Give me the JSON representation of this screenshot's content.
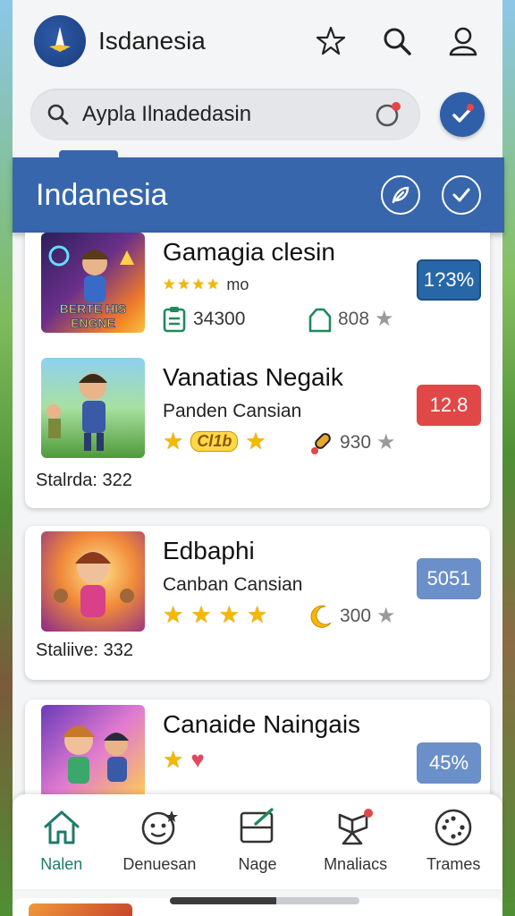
{
  "header": {
    "app_title": "Isdanesia"
  },
  "search": {
    "value": "Aypla Ilnadedasin"
  },
  "banner": {
    "title": "Indanesia"
  },
  "games": [
    {
      "title": "Gamagia clesin",
      "rating_text": "mo",
      "stat_value": "34300",
      "count": "808",
      "badge": "1?3%",
      "badge_color": "#2767a8"
    },
    {
      "title": "Vanatias Negaik",
      "subtitle": "Panden Cansian",
      "tag": "Cl1b",
      "count": "930",
      "badge": "12.8",
      "badge_color": "#e04848"
    },
    {
      "title": "Edbaphi",
      "subtitle": "Canban Cansian",
      "count": "300",
      "badge": "5051",
      "badge_color": "#6a8fc9"
    },
    {
      "title": "Canaide Naingais",
      "badge": "45%",
      "badge_color": "#6a8fc9"
    }
  ],
  "thumbnails": {
    "game1_text": "BERTE HIS ENGNE"
  },
  "card_footers": {
    "card1": "Stalrda: 322",
    "card2": "Staliive: 332"
  },
  "nav": {
    "items": [
      {
        "label": "Nalen",
        "icon": "home-icon",
        "active": true
      },
      {
        "label": "Denuesan",
        "icon": "face-icon"
      },
      {
        "label": "Nage",
        "icon": "edit-box-icon"
      },
      {
        "label": "Mnaliacs",
        "icon": "pennant-icon"
      },
      {
        "label": "Trames",
        "icon": "dots-circle-icon"
      }
    ]
  },
  "colors": {
    "primary": "#3766ad",
    "active_nav": "#1f7a6a"
  }
}
